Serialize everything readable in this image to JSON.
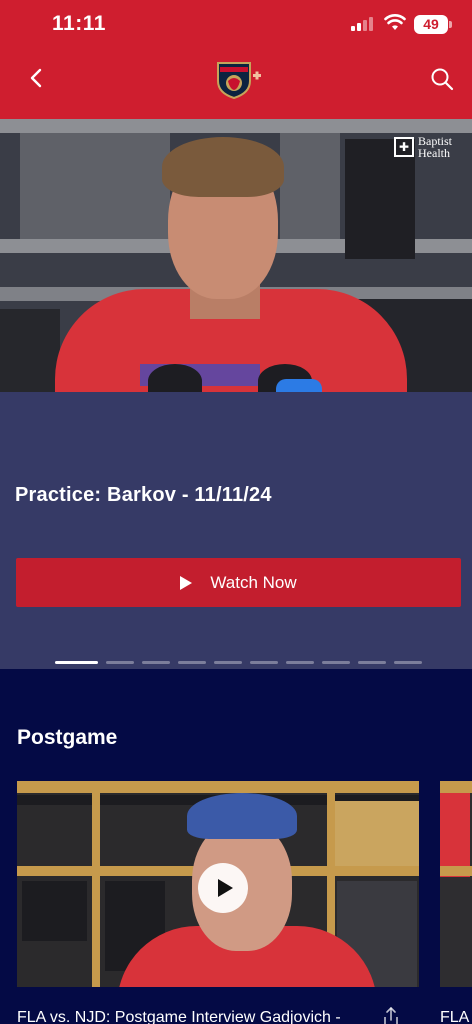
{
  "status_bar": {
    "time": "11:11",
    "battery": "49"
  },
  "header": {
    "back_icon": "chevron-left-icon",
    "logo": "panthers-logo",
    "search_icon": "search-icon"
  },
  "hero": {
    "sponsor_line1": "Baptist",
    "sponsor_line2": "Health"
  },
  "featured": {
    "title": "Practice: Barkov - 11/11/24",
    "watch_label": "Watch Now",
    "pager_total": 10,
    "pager_active": 1
  },
  "postgame": {
    "section_title": "Postgame",
    "cards": [
      {
        "title": "FLA vs. NJD: Postgame Interview Gadjovich -"
      },
      {
        "title": "FLA"
      }
    ]
  },
  "colors": {
    "header_red": "#cf1e2f",
    "button_red": "#c31e2e",
    "featured_bg": "#363a66",
    "page_bg": "#040a45"
  }
}
